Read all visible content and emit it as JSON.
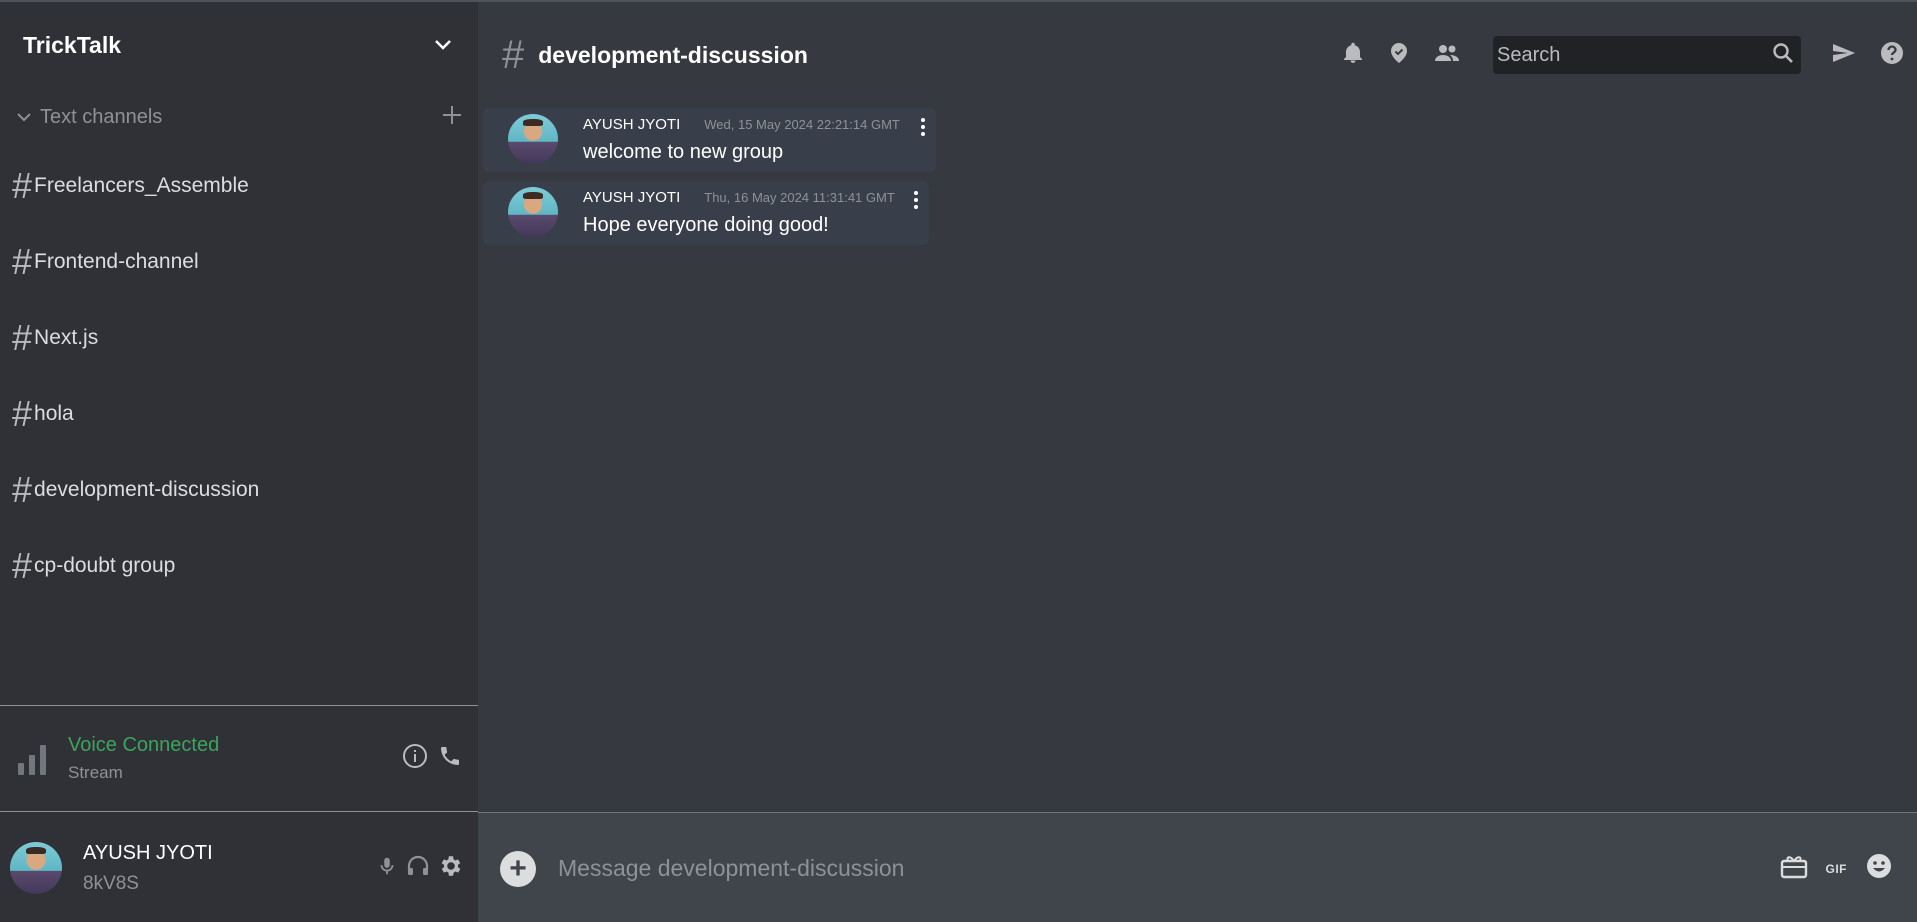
{
  "server": {
    "name": "TrickTalk"
  },
  "channels_section": {
    "label": "Text channels"
  },
  "channels": [
    {
      "hash": "#",
      "name": "Freelancers_Assemble"
    },
    {
      "hash": "#",
      "name": "Frontend-channel"
    },
    {
      "hash": "#",
      "name": "Next.js"
    },
    {
      "hash": "#",
      "name": "hola"
    },
    {
      "hash": "#",
      "name": "development-discussion"
    },
    {
      "hash": "#",
      "name": "cp-doubt group"
    }
  ],
  "voice": {
    "status": "Voice Connected",
    "sub": "Stream"
  },
  "user": {
    "name": "AYUSH JYOTI",
    "tag": "8kV8S"
  },
  "header": {
    "hash": "#",
    "title": "development-discussion"
  },
  "search": {
    "placeholder": "Search"
  },
  "messages": [
    {
      "author": "AYUSH JYOTI",
      "time": "Wed, 15 May 2024 22:21:14 GMT",
      "text": "welcome to new group"
    },
    {
      "author": "AYUSH JYOTI",
      "time": "Thu, 16 May 2024 11:31:41 GMT",
      "text": "Hope everyone doing good!"
    }
  ],
  "composer": {
    "placeholder": "Message development-discussion",
    "plus": "+",
    "gif_label": "GIF"
  },
  "colors": {
    "voice_green": "#3ba55c",
    "background": "#36393f",
    "sidebar": "#2f3136"
  }
}
